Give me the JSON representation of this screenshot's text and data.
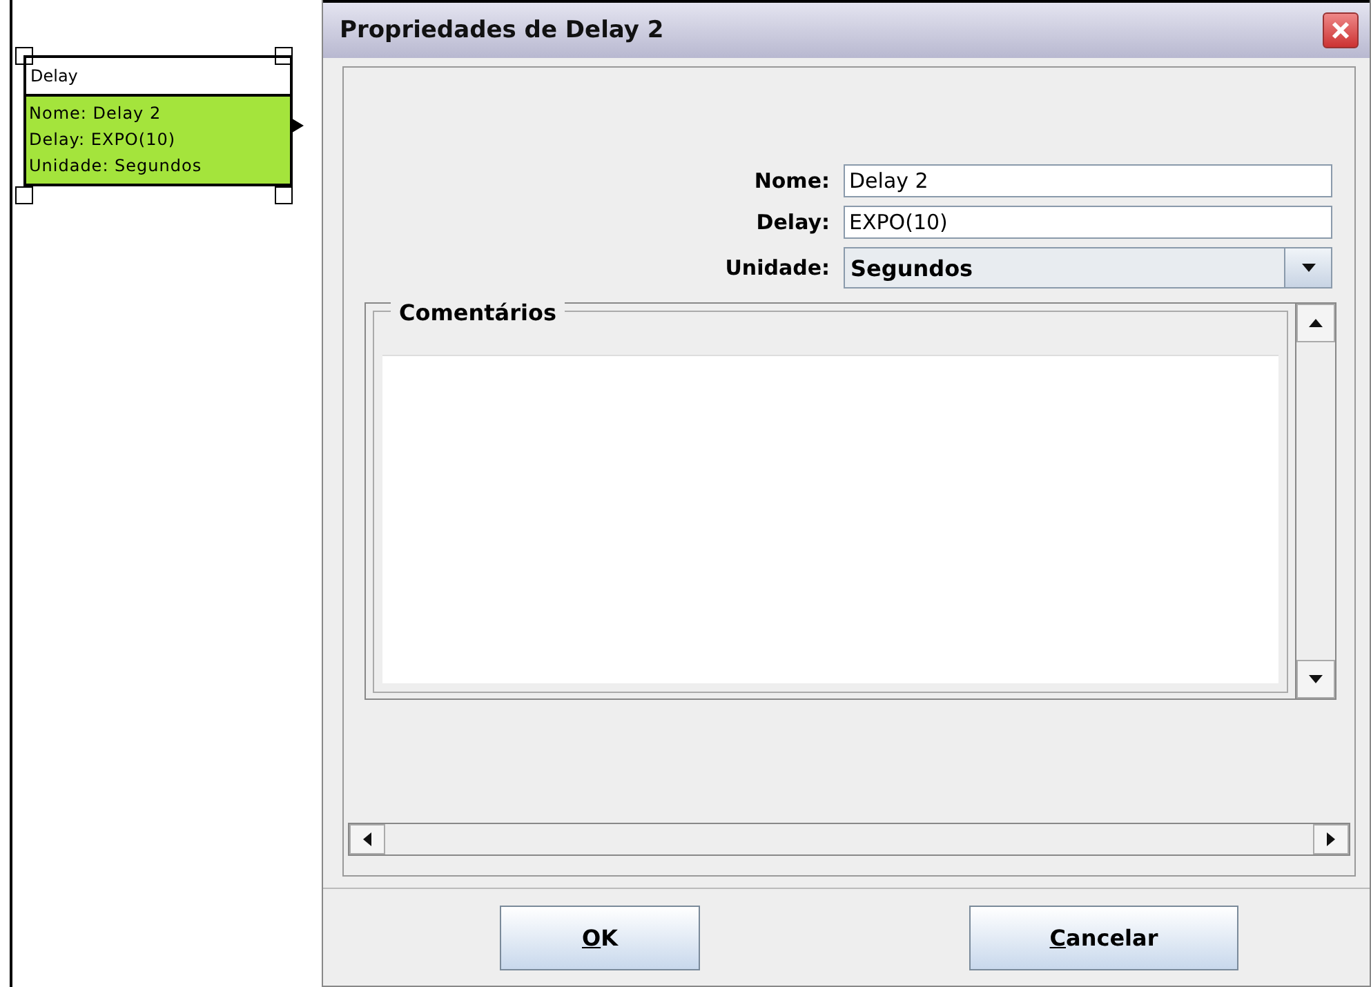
{
  "canvas": {
    "block": {
      "title": "Delay",
      "lines": [
        "Nome: Delay 2",
        "Delay: EXPO(10)",
        "Unidade: Segundos"
      ],
      "selected": true
    }
  },
  "dialog": {
    "title": "Propriedades de Delay 2",
    "fields": [
      {
        "kind": "text",
        "label": "Nome:",
        "value": "Delay 2"
      },
      {
        "kind": "text",
        "label": "Delay:",
        "value": "EXPO(10)"
      },
      {
        "kind": "combo",
        "label": "Unidade:",
        "value": "Segundos"
      }
    ],
    "comments": {
      "title": "Comentários"
    },
    "buttons": [
      {
        "label": "OK",
        "underline_first": true
      },
      {
        "label": "Cancelar",
        "underline_first": true
      }
    ]
  }
}
